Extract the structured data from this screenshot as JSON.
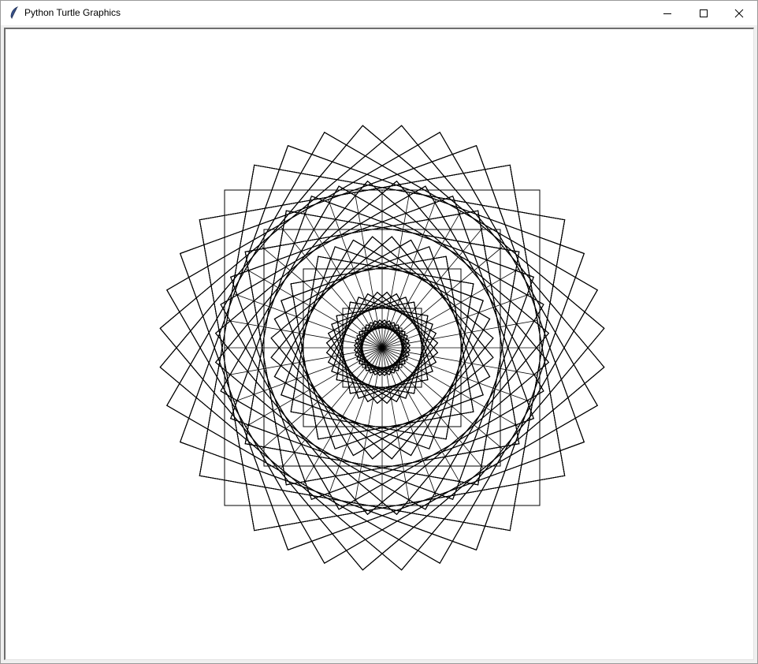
{
  "window": {
    "title": "Python Turtle Graphics",
    "app_icon": "feather-icon",
    "controls": {
      "minimize": "minimize-icon",
      "maximize": "maximize-icon",
      "close": "close-icon"
    }
  },
  "canvas": {
    "background": "#ffffff",
    "pen_color": "#000000",
    "drawing": "nested rotating squares",
    "rings": [
      {
        "square_size": 200,
        "count": 36,
        "rotation_step_deg": 10
      },
      {
        "square_size": 150,
        "count": 36,
        "rotation_step_deg": 10
      },
      {
        "square_size": 100,
        "count": 36,
        "rotation_step_deg": 10
      },
      {
        "square_size": 50,
        "count": 36,
        "rotation_step_deg": 10
      },
      {
        "square_size": 25,
        "count": 36,
        "rotation_step_deg": 10
      }
    ]
  }
}
